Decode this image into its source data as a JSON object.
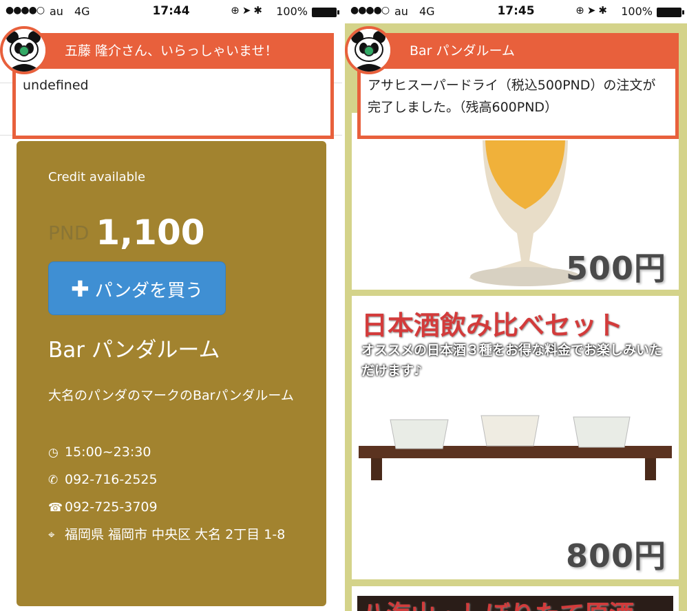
{
  "left": {
    "status": {
      "signal": "●●●●○",
      "carrier": "au",
      "network": "4G",
      "time": "17:44",
      "icons": "⊕➤✱",
      "battery": "100%"
    },
    "notification": {
      "title": "五藤 隆介さん、いらっしゃいませ！",
      "message": "undefined"
    },
    "card": {
      "credit_label": "Credit available",
      "currency": "PND",
      "amount": "1,100",
      "buy_button": "パンダを買う",
      "bar_name": "Bar パンダルーム",
      "description": "大名のパンダのマークのBarパンダルーム",
      "hours": "15:00~23:30",
      "phone": "092-716-2525",
      "fax": "092-725-3709",
      "address": "福岡県 福岡市 中央区 大名 2丁目 1-8"
    }
  },
  "right": {
    "status": {
      "signal": "●●●●○",
      "carrier": "au",
      "network": "4G",
      "time": "17:45",
      "icons": "⊕➤✱",
      "battery": "100%"
    },
    "notification": {
      "title": "Bar パンダルーム",
      "message": "アサヒスーパードライ（税込500PND）の注文が完了しました。（残高600PND）"
    },
    "items": [
      {
        "price": "500円"
      },
      {
        "title": "日本酒飲み比べセット",
        "subtitle": "オススメの日本酒３種をお得な料金でお楽しみいただけます♪",
        "price": "800円"
      },
      {
        "title": "八海山・しぼりたて原酒"
      }
    ]
  },
  "colors": {
    "accent": "#e8603c",
    "card": "#a2832f",
    "button": "#3f8fd3",
    "list_bg": "#d4d38a"
  }
}
